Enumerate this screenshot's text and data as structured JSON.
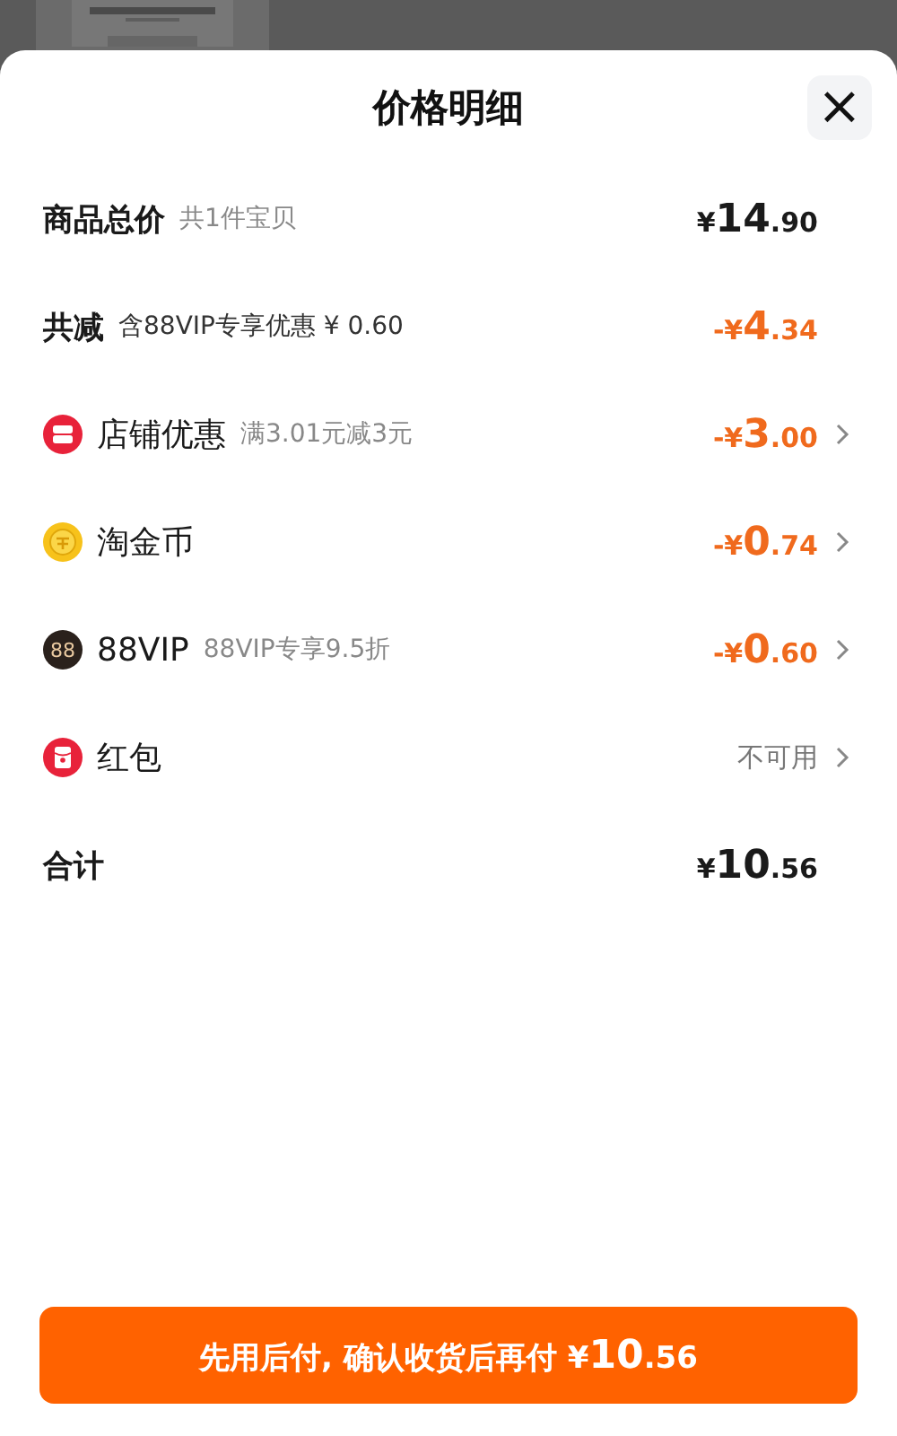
{
  "sheet": {
    "title": "价格明细",
    "close_icon": "×"
  },
  "rows": [
    {
      "kind": "plain",
      "label": "商品总价",
      "note": "共1件宝贝",
      "amount": "¥14.90",
      "discount": false,
      "chevron": false
    },
    {
      "kind": "summary",
      "label": "共减",
      "note": "含88VIP专享优惠 ¥ 0.60",
      "amount": "-¥4.34",
      "discount": true,
      "chevron": false
    },
    {
      "kind": "shop",
      "label": "店铺优惠",
      "note": "满3.01元减3元",
      "amount": "-¥3.00",
      "discount": true,
      "chevron": true
    },
    {
      "kind": "coin",
      "label": "淘金币",
      "amount": "-¥0.74",
      "discount": true,
      "chevron": true
    },
    {
      "kind": "vip",
      "label": "88VIP",
      "badge": "88",
      "note": "88VIP专享9.5折",
      "amount": "-¥0.60",
      "discount": true,
      "chevron": true
    },
    {
      "kind": "redpacket",
      "label": "红包",
      "amount": "不可用",
      "disabled": true,
      "discount": false,
      "chevron": true
    },
    {
      "kind": "plain",
      "label": "合计",
      "amount": "¥10.56",
      "discount": false,
      "chevron": false
    }
  ],
  "pay_button": {
    "label": "先用后付, 确认收货后再付",
    "amount": "¥10.56"
  }
}
